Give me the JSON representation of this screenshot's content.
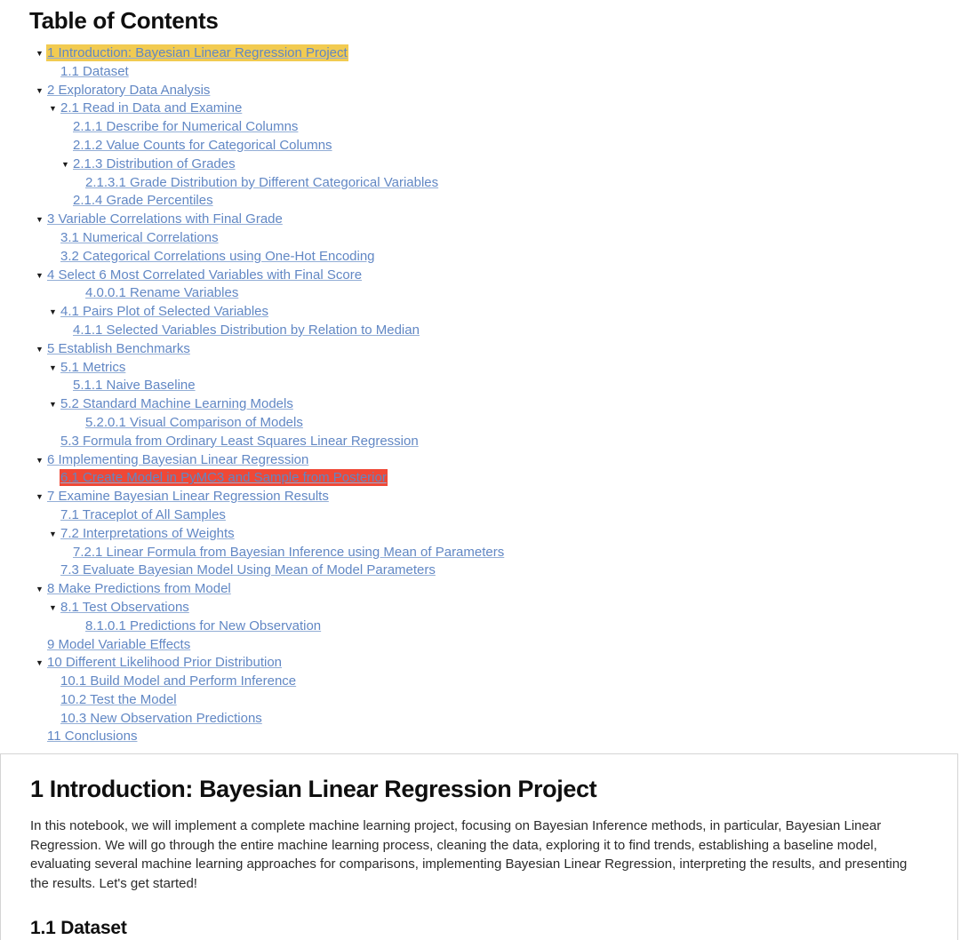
{
  "toc": {
    "title": "Table of Contents",
    "caret_glyph": "▼",
    "colors": {
      "link": "#6187c4",
      "highlight_yellow": "#f2cb51",
      "highlight_red": "#f04836",
      "caret": "#1c1c1c",
      "cell_border": "#d4d4d4"
    },
    "items": [
      {
        "label": "1  Introduction: Bayesian Linear Regression Project",
        "level": 1,
        "caret": true,
        "highlight": "yellow"
      },
      {
        "label": "1.1  Dataset",
        "level": 2,
        "caret": false,
        "highlight": "none"
      },
      {
        "label": "2  Exploratory Data Analysis",
        "level": 1,
        "caret": true,
        "highlight": "none"
      },
      {
        "label": "2.1  Read in Data and Examine",
        "level": 2,
        "caret": true,
        "highlight": "none"
      },
      {
        "label": "2.1.1  Describe for Numerical Columns",
        "level": 3,
        "caret": false,
        "highlight": "none"
      },
      {
        "label": "2.1.2  Value Counts for Categorical Columns",
        "level": 3,
        "caret": false,
        "highlight": "none"
      },
      {
        "label": "2.1.3  Distribution of Grades",
        "level": 3,
        "caret": true,
        "highlight": "none"
      },
      {
        "label": "2.1.3.1  Grade Distribution by Different Categorical Variables",
        "level": 4,
        "caret": false,
        "highlight": "none"
      },
      {
        "label": "2.1.4  Grade Percentiles",
        "level": 3,
        "caret": false,
        "highlight": "none"
      },
      {
        "label": "3  Variable Correlations with Final Grade",
        "level": 1,
        "caret": true,
        "highlight": "none"
      },
      {
        "label": "3.1  Numerical Correlations",
        "level": 2,
        "caret": false,
        "highlight": "none"
      },
      {
        "label": "3.2  Categorical Correlations using One-Hot Encoding",
        "level": 2,
        "caret": false,
        "highlight": "none"
      },
      {
        "label": "4  Select 6 Most Correlated Variables with Final Score",
        "level": 1,
        "caret": true,
        "highlight": "none"
      },
      {
        "label": "4.0.0.1  Rename Variables",
        "level": 4,
        "caret": false,
        "highlight": "none"
      },
      {
        "label": "4.1  Pairs Plot of Selected Variables",
        "level": 2,
        "caret": true,
        "highlight": "none"
      },
      {
        "label": "4.1.1  Selected Variables Distribution by Relation to Median",
        "level": 3,
        "caret": false,
        "highlight": "none"
      },
      {
        "label": "5  Establish Benchmarks",
        "level": 1,
        "caret": true,
        "highlight": "none"
      },
      {
        "label": "5.1  Metrics",
        "level": 2,
        "caret": true,
        "highlight": "none"
      },
      {
        "label": "5.1.1  Naive Baseline",
        "level": 3,
        "caret": false,
        "highlight": "none"
      },
      {
        "label": "5.2  Standard Machine Learning Models",
        "level": 2,
        "caret": true,
        "highlight": "none"
      },
      {
        "label": "5.2.0.1  Visual Comparison of Models",
        "level": 4,
        "caret": false,
        "highlight": "none"
      },
      {
        "label": "5.3  Formula from Ordinary Least Squares Linear Regression",
        "level": 2,
        "caret": false,
        "highlight": "none"
      },
      {
        "label": "6  Implementing Bayesian Linear Regression",
        "level": 1,
        "caret": true,
        "highlight": "none"
      },
      {
        "label": "6.1  Create Model in PyMC3 and Sample from Posterior",
        "level": 2,
        "caret": false,
        "highlight": "red"
      },
      {
        "label": "7  Examine Bayesian Linear Regression Results",
        "level": 1,
        "caret": true,
        "highlight": "none"
      },
      {
        "label": "7.1  Traceplot of All Samples",
        "level": 2,
        "caret": false,
        "highlight": "none"
      },
      {
        "label": "7.2  Interpretations of Weights",
        "level": 2,
        "caret": true,
        "highlight": "none"
      },
      {
        "label": "7.2.1  Linear Formula from Bayesian Inference using Mean of Parameters",
        "level": 3,
        "caret": false,
        "highlight": "none"
      },
      {
        "label": "7.3  Evaluate Bayesian Model Using Mean of Model Parameters",
        "level": 2,
        "caret": false,
        "highlight": "none"
      },
      {
        "label": "8  Make Predictions from Model",
        "level": 1,
        "caret": true,
        "highlight": "none"
      },
      {
        "label": "8.1  Test Observations",
        "level": 2,
        "caret": true,
        "highlight": "none"
      },
      {
        "label": "8.1.0.1  Predictions for New Observation",
        "level": 4,
        "caret": false,
        "highlight": "none"
      },
      {
        "label": "9  Model Variable Effects",
        "level": 1,
        "caret": false,
        "highlight": "none"
      },
      {
        "label": "10  Different Likelihood Prior Distribution",
        "level": 1,
        "caret": true,
        "highlight": "none"
      },
      {
        "label": "10.1  Build Model and Perform Inference",
        "level": 2,
        "caret": false,
        "highlight": "none"
      },
      {
        "label": "10.2  Test the Model",
        "level": 2,
        "caret": false,
        "highlight": "none"
      },
      {
        "label": "10.3  New Observation Predictions",
        "level": 2,
        "caret": false,
        "highlight": "none"
      },
      {
        "label": "11  Conclusions",
        "level": 1,
        "caret": false,
        "highlight": "none"
      }
    ]
  },
  "content": {
    "heading_1": "1  Introduction: Bayesian Linear Regression Project",
    "paragraph_1": "In this notebook, we will implement a complete machine learning project, focusing on Bayesian Inference methods, in particular, Bayesian Linear Regression. We will go through the entire machine learning process, cleaning the data, exploring it to find trends, establishing a baseline model, evaluating several machine learning approaches for comparisons, implementing Bayesian Linear Regression, interpreting the results, and presenting the results. Let's get started!",
    "heading_1_1": "1.1  Dataset"
  }
}
